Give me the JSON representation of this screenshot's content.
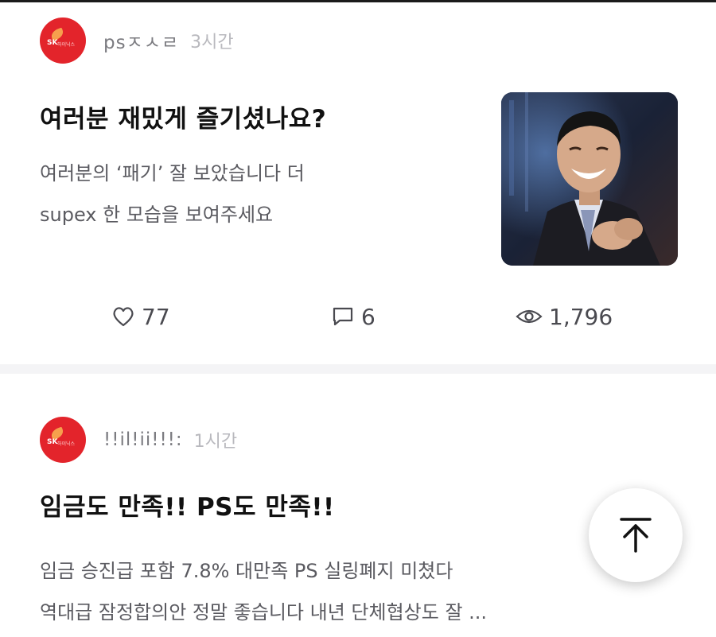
{
  "feed": {
    "posts": [
      {
        "author": "psㅈㅅㄹ",
        "time": "3시간",
        "title": "여러분 재밌게 즐기셨나요?",
        "body_lines": [
          "여러분의 ‘패기’ 잘 보았습니다 더",
          "supex 한 모습을 보여주세요"
        ],
        "likes": "77",
        "comments": "6",
        "views": "1,796",
        "thumbnail_icon": "person-photo-thumbnail"
      },
      {
        "author": "!!il!ii!!!:",
        "time": "1시간",
        "title": "임금도 만족!! PS도 만족!!",
        "body_lines": [
          "임금 승진급 포함 7.8%  대만족  PS 실링폐지 미쳤다",
          "역대급 잠정합의안 정말 좋습니다  내년 단체협상도 잘 ..."
        ]
      }
    ]
  },
  "avatar": {
    "logo_text": "SK",
    "logo_tag": "하이닉스"
  },
  "icons": {
    "like": "heart-icon",
    "comment": "comment-icon",
    "views": "eye-icon",
    "scroll_top": "arrow-up-icon"
  },
  "colors": {
    "avatar_red": "#e3242b",
    "text_primary": "#111111",
    "text_secondary": "#5a5a60",
    "meta_gray": "#b9b9be"
  }
}
